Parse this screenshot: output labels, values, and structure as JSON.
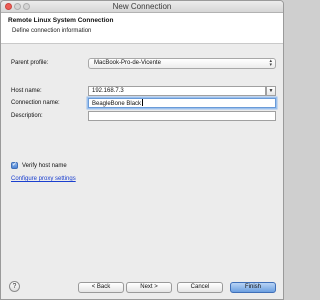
{
  "window": {
    "title": "New Connection"
  },
  "banner": {
    "title": "Remote Linux System Connection",
    "description": "Define connection information"
  },
  "form": {
    "parent_profile_label": "Parent profile:",
    "parent_profile_value": "MacBook-Pro-de-Vicente",
    "host_name_label": "Host name:",
    "host_name_value": "192.168.7.3",
    "connection_name_label": "Connection name:",
    "connection_name_value": "BeagleBone Black",
    "description_label": "Description:",
    "description_value": "",
    "verify_host_label": "Verify host name",
    "verify_host_checked": true,
    "proxy_link": "Configure proxy settings"
  },
  "footer": {
    "help_glyph": "?",
    "back_label": "< Back",
    "next_label": "Next >",
    "cancel_label": "Cancel",
    "finish_label": "Finish"
  },
  "colors": {
    "accent": "#4f86d6",
    "link": "#1a3fcf",
    "close_button": "#ee5d56"
  }
}
